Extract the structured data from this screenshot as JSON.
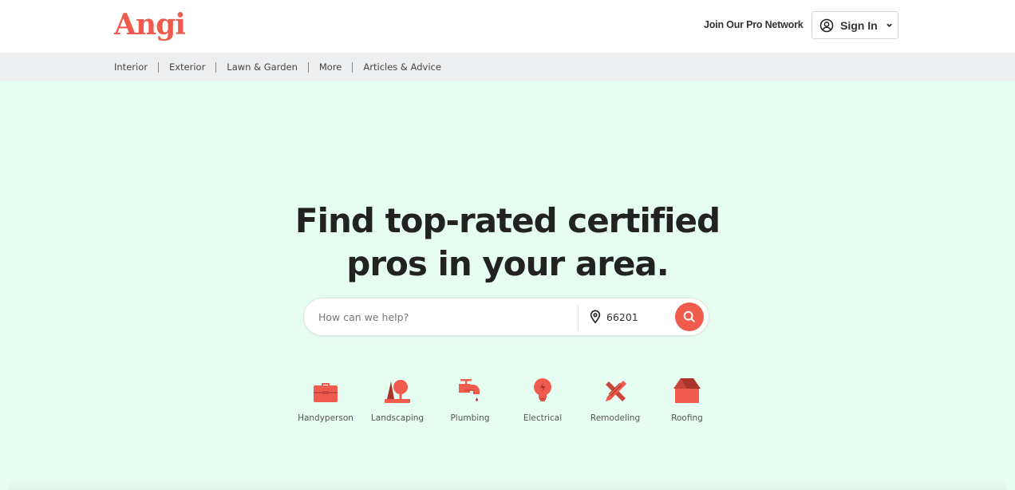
{
  "header": {
    "logo": "Angi",
    "join_link": "Join Our Pro Network",
    "signin_label": "Sign In"
  },
  "nav": {
    "items": [
      "Interior",
      "Exterior",
      "Lawn & Garden",
      "More",
      "Articles & Advice"
    ]
  },
  "hero": {
    "title_line1": "Find top-rated certified",
    "title_line2": "pros in your area."
  },
  "search": {
    "placeholder": "How can we help?",
    "query_value": "",
    "zip_value": "66201"
  },
  "categories": [
    {
      "label": "Handyperson",
      "icon": "toolbox-icon"
    },
    {
      "label": "Landscaping",
      "icon": "trees-icon"
    },
    {
      "label": "Plumbing",
      "icon": "faucet-icon"
    },
    {
      "label": "Electrical",
      "icon": "lightbulb-icon"
    },
    {
      "label": "Remodeling",
      "icon": "ruler-pencil-icon"
    },
    {
      "label": "Roofing",
      "icon": "house-roof-icon"
    }
  ],
  "colors": {
    "brand": "#ef5b4c",
    "hero_background": "#e6fdf1",
    "nav_background": "#eeeff1",
    "text_dark": "#222222"
  }
}
